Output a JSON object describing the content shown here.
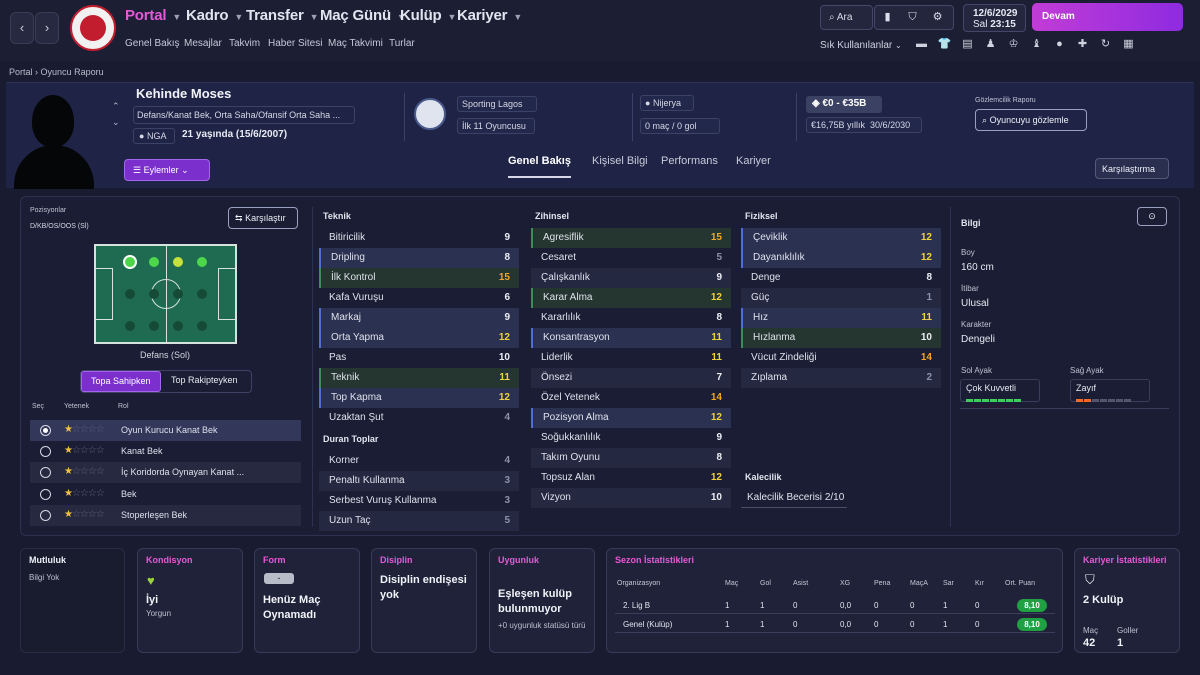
{
  "nav": {
    "back": "‹",
    "forward": "›",
    "menus": [
      "Portal",
      "Kadro",
      "Transfer",
      "Maç Günü",
      "Kulüp",
      "Kariyer"
    ],
    "sub": [
      "Genel Bakış",
      "Mesajlar",
      "Takvim",
      "Haber Sitesi",
      "Maç Takvimi",
      "Turlar"
    ],
    "search": "Ara",
    "date": "12/6/2029",
    "daytime": "Sal",
    "time": "23:15",
    "continue": "Devam",
    "shortcuts": "Sık Kullanılanlar"
  },
  "breadcrumb": {
    "root": "Portal",
    "sep": "›",
    "page": "Oyuncu Raporu"
  },
  "player": {
    "name": "Kehinde Moses",
    "positions": "Defans/Kanat Bek, Orta Saha/Ofansif Orta Saha ...",
    "nation_code": "NGA",
    "age": "21 yaşında (15/6/2007)",
    "club": "Sporting Lagos",
    "squad": "İlk 11 Oyuncusu",
    "nation": "Nijerya",
    "apps": "0 maç / 0 gol",
    "value": "€0 - €35B",
    "wage": "€16,75B yıllık",
    "contract": "30/6/2030",
    "scout_label": "Gözlemcilik Raporu",
    "scout_btn": "Oyuncuyu gözlemle",
    "actions": "Eylemler",
    "compare": "Karşılaştırma"
  },
  "tabs": [
    "Genel Bakış",
    "Kişisel Bilgi",
    "Performans",
    "Kariyer"
  ],
  "positions": {
    "label": "Pozisyonlar",
    "codes": "D/KB/OS/OOS (Sl)",
    "compare": "Karşılaştır",
    "caption": "Defans (Sol)",
    "toggle_on": "Topa Sahipken",
    "toggle_off": "Top Rakipteyken",
    "hdr_select": "Seç",
    "hdr_ability": "Yetenek",
    "hdr_role": "Rol",
    "roles": [
      "Oyun Kurucu Kanat Bek",
      "Kanat Bek",
      "İç Koridorda Oynayan Kanat ...",
      "Bek",
      "Stoperleşen Bek"
    ]
  },
  "teknik": {
    "title": "Teknik",
    "items": [
      [
        "Bitiricilik",
        "9"
      ],
      [
        "Dripling",
        "8"
      ],
      [
        "İlk Kontrol",
        "15"
      ],
      [
        "Kafa Vuruşu",
        "6"
      ],
      [
        "Markaj",
        "9"
      ],
      [
        "Orta Yapma",
        "12"
      ],
      [
        "Pas",
        "10"
      ],
      [
        "Teknik",
        "11"
      ],
      [
        "Top Kapma",
        "12"
      ],
      [
        "Uzaktan Şut",
        "4"
      ]
    ]
  },
  "duran": {
    "title": "Duran Toplar",
    "items": [
      [
        "Korner",
        "4"
      ],
      [
        "Penaltı Kullanma",
        "3"
      ],
      [
        "Serbest Vuruş Kullanma",
        "3"
      ],
      [
        "Uzun Taç",
        "5"
      ]
    ]
  },
  "zihinsel": {
    "title": "Zihinsel",
    "items": [
      [
        "Agresiflik",
        "15"
      ],
      [
        "Cesaret",
        "5"
      ],
      [
        "Çalışkanlık",
        "9"
      ],
      [
        "Karar Alma",
        "12"
      ],
      [
        "Kararlılık",
        "8"
      ],
      [
        "Konsantrasyon",
        "11"
      ],
      [
        "Liderlik",
        "11"
      ],
      [
        "Önsezi",
        "7"
      ],
      [
        "Özel Yetenek",
        "14"
      ],
      [
        "Pozisyon Alma",
        "12"
      ],
      [
        "Soğukkanlılık",
        "9"
      ],
      [
        "Takım Oyunu",
        "8"
      ],
      [
        "Topsuz Alan",
        "12"
      ],
      [
        "Vizyon",
        "10"
      ]
    ]
  },
  "fiziksel": {
    "title": "Fiziksel",
    "items": [
      [
        "Çeviklik",
        "12"
      ],
      [
        "Dayanıklılık",
        "12"
      ],
      [
        "Denge",
        "8"
      ],
      [
        "Güç",
        "1"
      ],
      [
        "Hız",
        "11"
      ],
      [
        "Hızlanma",
        "10"
      ],
      [
        "Vücut Zindeliği",
        "14"
      ],
      [
        "Zıplama",
        "2"
      ]
    ]
  },
  "kaleci": {
    "title": "Kalecilik",
    "label": "Kalecilik Becerisi",
    "value": "2/10"
  },
  "bilgi": {
    "title": "Bilgi",
    "boy_l": "Boy",
    "boy": "160 cm",
    "itibar_l": "İtibar",
    "itibar": "Ulusal",
    "karakter_l": "Karakter",
    "karakter": "Dengeli",
    "sol_l": "Sol Ayak",
    "sol": "Çok Kuvvetli",
    "sag_l": "Sağ Ayak",
    "sag": "Zayıf"
  },
  "cards": {
    "mutluluk": {
      "t": "Mutluluk",
      "s": "Bilgi Yok"
    },
    "kondisyon": {
      "t": "Kondisyon",
      "big": "İyi",
      "s": "Yorgun"
    },
    "form": {
      "t": "Form",
      "badge": "-",
      "big": "Henüz Maç Oynamadı"
    },
    "disiplin": {
      "t": "Disiplin",
      "big": "Disiplin endişesi yok"
    },
    "uygunluk": {
      "t": "Uygunluk",
      "big": "Eşleşen kulüp bulunmuyor",
      "s": "+0 uygunluk statüsü türü"
    },
    "kariyer": {
      "t": "Kariyer İstatistikleri",
      "big": "2 Kulüp",
      "mac_l": "Maç",
      "mac": "42",
      "gol_l": "Goller",
      "gol": "1"
    }
  },
  "sezon": {
    "title": "Sezon İstatistikleri",
    "headers": [
      "Organizasyon",
      "Maç",
      "Gol",
      "Asist",
      "XG",
      "Pena",
      "MaçA",
      "Sar",
      "Kır",
      "Ort. Puan"
    ],
    "rows": [
      [
        "2. Lig B",
        "1",
        "1",
        "0",
        "0,0",
        "0",
        "0",
        "1",
        "0",
        "8,10"
      ],
      [
        "Genel (Kulüp)",
        "1",
        "1",
        "0",
        "0,0",
        "0",
        "0",
        "1",
        "0",
        "8,10"
      ]
    ]
  }
}
